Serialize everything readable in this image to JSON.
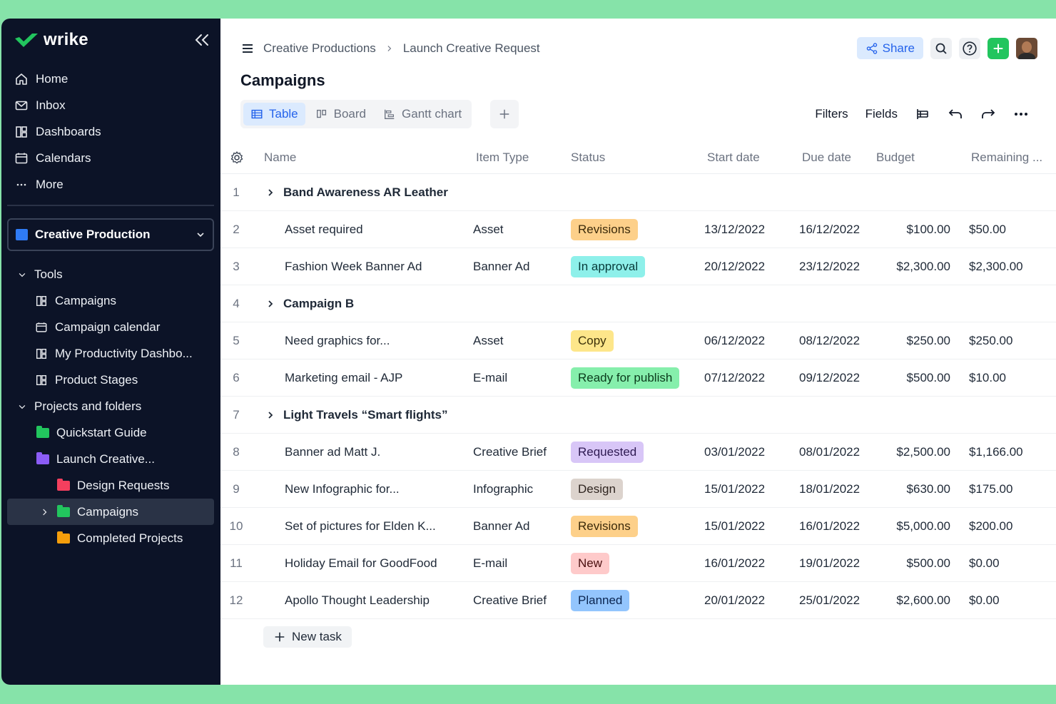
{
  "sidebar": {
    "logo": "wrike",
    "nav": [
      {
        "label": "Home",
        "icon": "home-icon"
      },
      {
        "label": "Inbox",
        "icon": "inbox-icon"
      },
      {
        "label": "Dashboards",
        "icon": "dashboard-icon"
      },
      {
        "label": "Calendars",
        "icon": "calendar-icon"
      },
      {
        "label": "More",
        "icon": "more-icon"
      }
    ],
    "space": "Creative Production",
    "tree": [
      {
        "label": "Tools"
      },
      {
        "label": "Campaigns"
      },
      {
        "label": "Campaign calendar"
      },
      {
        "label": "My Productivity Dashbo..."
      },
      {
        "label": "Product Stages"
      },
      {
        "label": "Projects and folders"
      },
      {
        "label": "Quickstart Guide"
      },
      {
        "label": "Launch Creative..."
      },
      {
        "label": "Design Requests"
      },
      {
        "label": "Campaigns"
      },
      {
        "label": "Completed Projects"
      }
    ]
  },
  "breadcrumb": {
    "parent": "Creative Productions",
    "current": "Launch Creative Request"
  },
  "header": {
    "share_label": "Share"
  },
  "page_title": "Campaigns",
  "views": {
    "table": "Table",
    "board": "Board",
    "gantt": "Gantt chart"
  },
  "toolbar": {
    "filters": "Filters",
    "fields": "Fields"
  },
  "columns": {
    "name": "Name",
    "item_type": "Item Type",
    "status": "Status",
    "start": "Start date",
    "due": "Due date",
    "budget": "Budget",
    "remaining": "Remaining ..."
  },
  "rows": [
    {
      "num": "1",
      "group": true,
      "name": "Band Awareness AR Leather"
    },
    {
      "num": "2",
      "name": "Asset required",
      "type": "Asset",
      "status": "Revisions",
      "start": "13/12/2022",
      "due": "16/12/2022",
      "budget": "$100.00",
      "remaining": "$50.00"
    },
    {
      "num": "3",
      "name": "Fashion Week Banner Ad",
      "type": "Banner Ad",
      "status": "In approval",
      "start": "20/12/2022",
      "due": "23/12/2022",
      "budget": "$2,300.00",
      "remaining": "$2,300.00"
    },
    {
      "num": "4",
      "group": true,
      "name": "Campaign B"
    },
    {
      "num": "5",
      "name": "Need graphics for...",
      "type": "Asset",
      "status": "Copy",
      "start": "06/12/2022",
      "due": "08/12/2022",
      "budget": "$250.00",
      "remaining": "$250.00"
    },
    {
      "num": "6",
      "name": "Marketing email - AJP",
      "type": "E-mail",
      "status": "Ready for publish",
      "start": "07/12/2022",
      "due": "09/12/2022",
      "budget": "$500.00",
      "remaining": "$10.00"
    },
    {
      "num": "7",
      "group": true,
      "name": "Light Travels “Smart flights”"
    },
    {
      "num": "8",
      "name": "Banner ad Matt J.",
      "type": "Creative Brief",
      "status": "Requested",
      "start": "03/01/2022",
      "due": "08/01/2022",
      "budget": "$2,500.00",
      "remaining": "$1,166.00"
    },
    {
      "num": "9",
      "name": "New Infographic for...",
      "type": "Infographic",
      "status": "Design",
      "start": "15/01/2022",
      "due": "18/01/2022",
      "budget": "$630.00",
      "remaining": "$175.00"
    },
    {
      "num": "10",
      "name": "Set of pictures for Elden K...",
      "type": "Banner Ad",
      "status": "Revisions",
      "start": "15/01/2022",
      "due": "16/01/2022",
      "budget": "$5,000.00",
      "remaining": "$200.00"
    },
    {
      "num": "11",
      "name": "Holiday Email for GoodFood",
      "type": "E-mail",
      "status": "New",
      "start": "16/01/2022",
      "due": "19/01/2022",
      "budget": "$500.00",
      "remaining": "$0.00"
    },
    {
      "num": "12",
      "name": "Apollo Thought Leadership",
      "type": "Creative Brief",
      "status": "Planned",
      "start": "20/01/2022",
      "due": "25/01/2022",
      "budget": "$2,600.00",
      "remaining": "$0.00"
    }
  ],
  "status_colors": {
    "Revisions": {
      "bg": "#fdd08a",
      "fg": "#3b2a0a"
    },
    "In approval": {
      "bg": "#8ef0ea",
      "fg": "#073b3a"
    },
    "Copy": {
      "bg": "#fde68a",
      "fg": "#3b300a"
    },
    "Ready for publish": {
      "bg": "#86efac",
      "fg": "#0b3b1c"
    },
    "Requested": {
      "bg": "#d8c6f7",
      "fg": "#2e1a52"
    },
    "Design": {
      "bg": "#dcd3cd",
      "fg": "#2f2520"
    },
    "New": {
      "bg": "#fecaca",
      "fg": "#4a1010"
    },
    "Planned": {
      "bg": "#93c5fd",
      "fg": "#0b2550"
    }
  },
  "new_task_label": "New task",
  "colors": {
    "sidebar_bg": "#0c1327",
    "accent": "#2563eb",
    "brand_green": "#22c55e",
    "page_bg": "#86e3a9"
  }
}
